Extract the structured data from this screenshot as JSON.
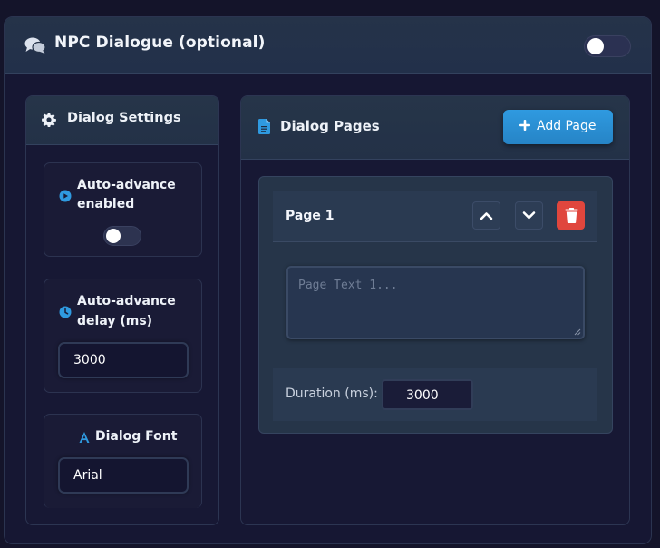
{
  "header": {
    "title": "NPC Dialogue (optional)",
    "icon": "chat-bubbles-icon",
    "enabled": false
  },
  "settings": {
    "title": "Dialog Settings",
    "icon": "gear-icon",
    "auto_advance": {
      "label_line1": "Auto-advance",
      "label_line2": "enabled",
      "icon": "play-circle-icon",
      "enabled": false
    },
    "delay": {
      "label_line1": "Auto-advance",
      "label_line2": "delay (ms)",
      "icon": "clock-icon",
      "value": "3000"
    },
    "font": {
      "label": "Dialog Font",
      "icon": "font-icon",
      "value": "Arial"
    }
  },
  "pages": {
    "title": "Dialog Pages",
    "icon": "document-icon",
    "add_label": "Add Page",
    "items": [
      {
        "title": "Page 1",
        "text_placeholder": "Page Text 1...",
        "text_value": "",
        "duration_label": "Duration (ms):",
        "duration_value": "3000"
      }
    ]
  },
  "colors": {
    "background": "#14142a",
    "panel_header": "#253349",
    "accent": "#2f9ae0",
    "danger": "#e0463d"
  }
}
